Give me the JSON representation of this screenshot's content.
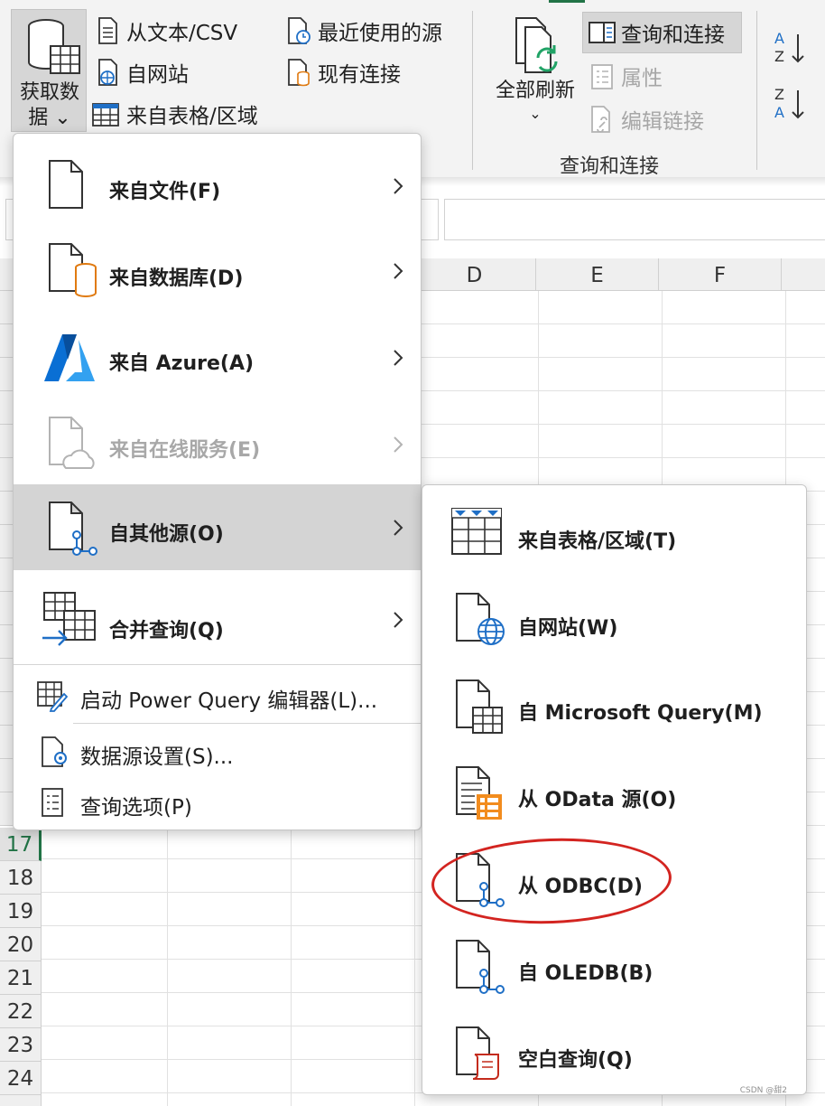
{
  "ribbon": {
    "get_data_label": "获取数\n据 ⌄",
    "get_data_line1": "获取数",
    "get_data_line2": "据 ⌄",
    "from_text_csv": "从文本/CSV",
    "from_web": "自网站",
    "from_table_range": "来自表格/区域",
    "recent_sources": "最近使用的源",
    "existing_connections": "现有连接",
    "refresh_all_line1": "全部刷新",
    "refresh_all_line2": "⌄",
    "queries_connections": "查询和连接",
    "properties": "属性",
    "edit_links": "编辑链接",
    "group_label": "查询和连接"
  },
  "sheet": {
    "columns": [
      "D",
      "E",
      "F"
    ],
    "rows": [
      "17",
      "18",
      "19",
      "20",
      "21",
      "22",
      "23",
      "24"
    ],
    "active_row": "17"
  },
  "main_menu": {
    "items": [
      {
        "label": "来自文件(F)",
        "icon": "file-icon",
        "state": "normal"
      },
      {
        "label": "来自数据库(D)",
        "icon": "database-icon",
        "state": "normal"
      },
      {
        "label": "来自 Azure(A)",
        "icon": "azure-icon",
        "state": "normal"
      },
      {
        "label": "来自在线服务(E)",
        "icon": "cloud-file-icon",
        "state": "disabled"
      },
      {
        "label": "自其他源(O)",
        "icon": "other-source-icon",
        "state": "selected"
      },
      {
        "label": "合并查询(Q)",
        "icon": "combine-query-icon",
        "state": "normal"
      }
    ],
    "launch_pq": "启动 Power Query 编辑器(L)...",
    "data_source_settings": "数据源设置(S)...",
    "query_options": "查询选项(P)"
  },
  "sub_menu": {
    "items": [
      {
        "label": "来自表格/区域(T)",
        "icon": "table-icon"
      },
      {
        "label": "自网站(W)",
        "icon": "web-file-icon"
      },
      {
        "label": "自 Microsoft Query(M)",
        "icon": "ms-query-icon"
      },
      {
        "label": "从 OData 源(O)",
        "icon": "odata-icon"
      },
      {
        "label": "从 ODBC(D)",
        "icon": "odbc-icon"
      },
      {
        "label": "自 OLEDB(B)",
        "icon": "oledb-icon"
      },
      {
        "label": "空白查询(Q)",
        "icon": "blank-query-icon"
      }
    ],
    "highlighted": "从 ODBC(D)"
  },
  "watermark": "CSDN @甜2",
  "colors": {
    "accent_green": "#217346",
    "highlight_red": "#d32420",
    "azure_blue": "#0a6fd4",
    "odata_orange": "#f28c1e"
  }
}
